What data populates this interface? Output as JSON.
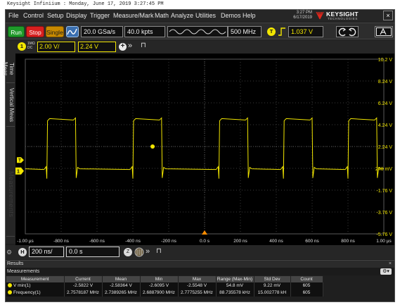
{
  "window": {
    "title": "Keysight Infiniium : Monday, June 17, 2019 3:27:45 PM"
  },
  "menu": {
    "items": [
      "File",
      "Control",
      "Setup",
      "Display",
      "Trigger",
      "Measure/Mark",
      "Math",
      "Analyze",
      "Utilities",
      "Demos",
      "Help"
    ]
  },
  "status": {
    "time": "3:27 PM",
    "date": "6/17/2019"
  },
  "brand": {
    "name": "KEYSIGHT",
    "subtitle": "TECHNOLOGIES",
    "accent_color": "#e0261c"
  },
  "toolbar": {
    "run_label": "Run",
    "stop_label": "Stop",
    "single_label": "Single",
    "sample_rate": "20.0 GSa/s",
    "memory_depth": "40.0 kpts",
    "bandwidth": "500 MHz",
    "trigger_badge": "T",
    "trigger_level": "1.037 V",
    "run_color": "#1f9a2a",
    "stop_color": "#d81f1f",
    "single_color": "#c98a00"
  },
  "channel": {
    "badge": "1",
    "coupling_line1": "1MΩ",
    "coupling_line2": "DC",
    "scale": "2.00 V/",
    "offset": "2.24 V",
    "color": "#f2e600"
  },
  "side_tabs": {
    "time_meas": "Time Meas",
    "vertical_meas": "Vertical Meas",
    "watermark": "Measurements"
  },
  "graticule": {
    "v_labels": [
      "10.2 V",
      "8.24 V",
      "6.24 V",
      "4.24 V",
      "2.24 V",
      "240 mV",
      "-1.76 V",
      "-3.76 V",
      "-5.76 V"
    ],
    "t_labels": [
      "-1.00 µs",
      "-800 ns",
      "-600 ns",
      "-400 ns",
      "-200 ns",
      "0.0 s",
      "200 ns",
      "400 ns",
      "600 ns",
      "800 ns",
      "1.00 µs"
    ],
    "ground_marker": "1",
    "trigger_marker": "T"
  },
  "chart_data": {
    "type": "line",
    "series": [
      {
        "name": "",
        "color": "#f2e600",
        "waveform": "square",
        "low_level_v": 0.2,
        "high_level_v": 4.6,
        "pulses_ns": [
          [
            -880,
            -720
          ],
          [
            -400,
            -240
          ],
          [
            80,
            240
          ],
          [
            440,
            600
          ],
          [
            800,
            960
          ]
        ]
      }
    ],
    "xlim": [
      -1000,
      1000
    ],
    "ylim": [
      -5.76,
      10.24
    ]
  },
  "timebase": {
    "badge": "H",
    "scale": "200 ns/",
    "position": "0.0 s",
    "zoom_badge": "Z"
  },
  "results": {
    "title": "Results",
    "close": "×",
    "subtitle": "Measurements",
    "columns": [
      "Measurement",
      "Current",
      "Mean",
      "Min",
      "Max",
      "Range (Max-Min)",
      "Std Dev",
      "Count"
    ],
    "rows": [
      [
        "V min(1)",
        "-2.5822 V",
        "-2.58364 V",
        "-2.6095 V",
        "-2.5548 V",
        "54.8 mV",
        "9.22 mV",
        "605"
      ],
      [
        "Frequency(1)",
        "2.7578187 MHz",
        "2.7389265 MHz",
        "2.6887900 MHz",
        "2.7775255 MHz",
        "88.735578 kHz",
        "15.002778 kH",
        "605"
      ]
    ]
  }
}
